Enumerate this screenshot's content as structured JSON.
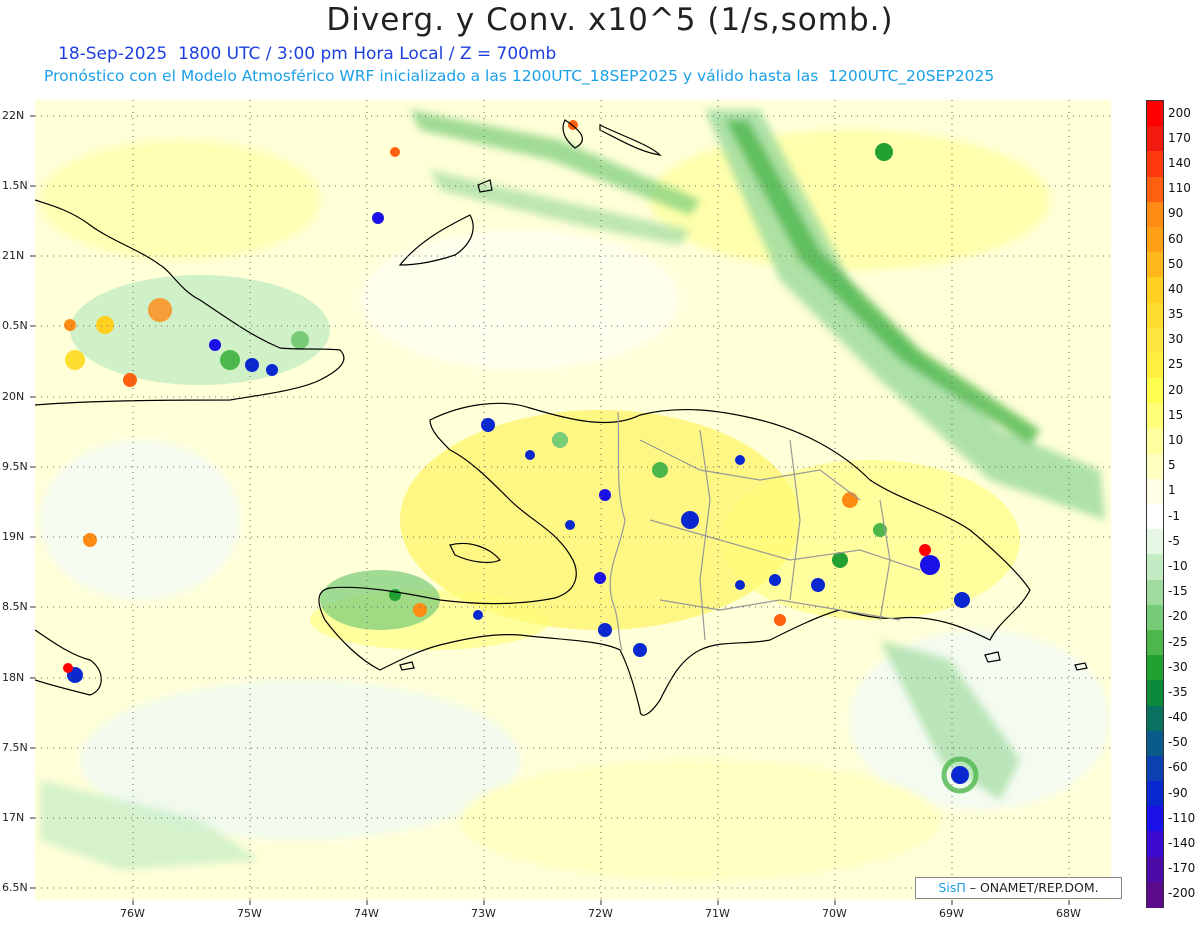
{
  "header": {
    "title": "Diverg. y Conv. x10^5 (1/s,somb.)",
    "subtitle1": "18-Sep-2025  1800 UTC / 3:00 pm Hora Local / Z = 700mb",
    "subtitle2": "Pronóstico con el Modelo Atmosférico WRF inicializado a las 1200UTC_18SEP2025 y válido hasta las  1200UTC_20SEP2025"
  },
  "map": {
    "lat_labels": [
      "22N",
      "1.5N",
      "21N",
      "0.5N",
      "20N",
      "9.5N",
      "19N",
      "8.5N",
      "18N",
      "7.5N",
      "17N",
      "6.5N"
    ],
    "lon_labels": [
      "76W",
      "75W",
      "74W",
      "73W",
      "72W",
      "71W",
      "70W",
      "69W",
      "68W"
    ],
    "region": "Hispaniola / Caribbean"
  },
  "legend": {
    "labels": [
      "200",
      "170",
      "140",
      "110",
      "90",
      "60",
      "50",
      "40",
      "35",
      "30",
      "25",
      "20",
      "15",
      "10",
      "5",
      "1",
      "-1",
      "-5",
      "-10",
      "-15",
      "-20",
      "-25",
      "-30",
      "-35",
      "-40",
      "-50",
      "-60",
      "-90",
      "-110",
      "-140",
      "-170",
      "-200"
    ],
    "colors": [
      "#ff0000",
      "#f21a0f",
      "#ff3a10",
      "#ff6010",
      "#ff8a14",
      "#ffa014",
      "#ffb81c",
      "#ffd020",
      "#ffdc30",
      "#ffe640",
      "#fff040",
      "#ffff50",
      "#ffff78",
      "#ffffa0",
      "#ffffc0",
      "#ffffe6",
      "#ffffff",
      "#e6f7e6",
      "#c4ecc4",
      "#a0dca0",
      "#78cc78",
      "#4cb84c",
      "#22a032",
      "#0a8a3a",
      "#0a7060",
      "#0a5a8a",
      "#0a40b0",
      "#0a28d0",
      "#1a10e8",
      "#3c0ad0",
      "#4c0aa8",
      "#5a0a8a"
    ]
  },
  "credit": {
    "brand": "SisΠ",
    "org": "– ONAMET/REP.DOM."
  }
}
